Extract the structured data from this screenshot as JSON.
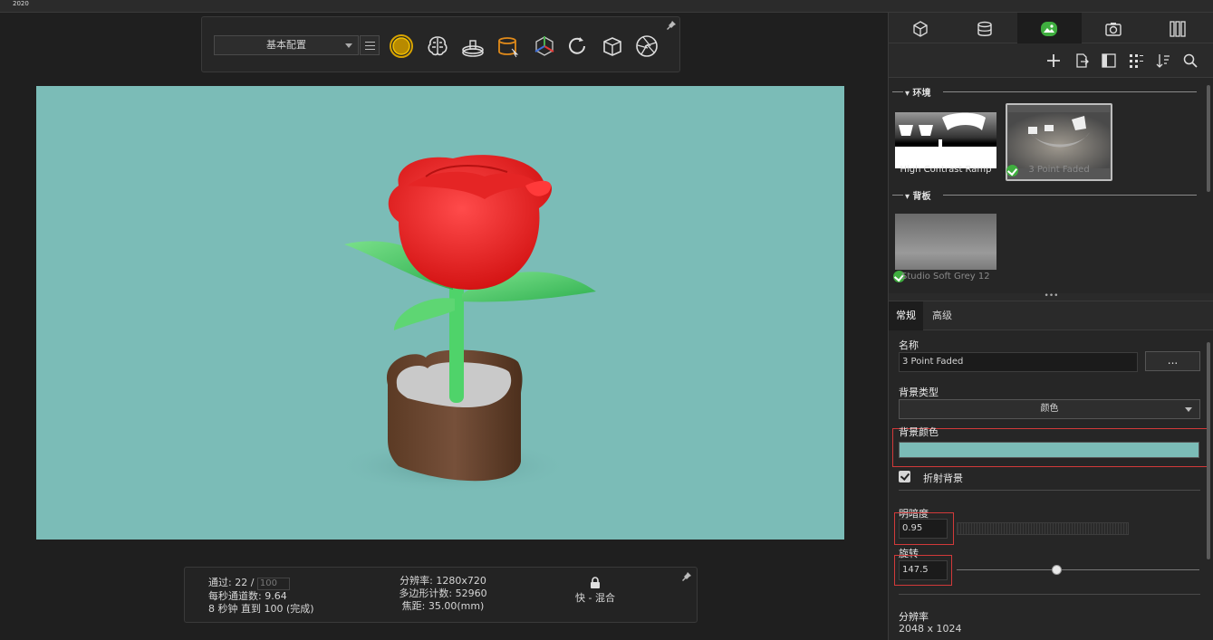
{
  "top_strip": {
    "year": "2020"
  },
  "toolbar": {
    "preset_value": "基本配置",
    "icons": [
      "sphere-icon",
      "brain-icon",
      "turntable-icon",
      "material-bucket-icon",
      "transform-icon",
      "refresh-icon",
      "box-icon",
      "aperture-icon"
    ]
  },
  "canvas": {
    "background_color": "#7bbcb7"
  },
  "status": {
    "pass_label": "通过:",
    "pass_current": "22 /",
    "pass_total": "100",
    "per_second_label": "每秒通道数:",
    "per_second_value": "9.64",
    "time_line": "8 秒钟 直到 100 (完成)",
    "resolution_line": "分辨率: 1280x720",
    "polygon_line": "多边形计数: 52960",
    "focal_line": "焦距: 35.00(mm)",
    "mode_label": "快 - 混合"
  },
  "right_tabs": [
    "cube-icon",
    "database-icon",
    "environment-icon",
    "camera-icon",
    "columns-icon"
  ],
  "right_actions": [
    "add-icon",
    "export-icon",
    "panel-icon",
    "grid-icon",
    "sort-icon",
    "search-icon"
  ],
  "library": {
    "env_section": "▾ 环境",
    "env_items": [
      {
        "label": "High Contrast Ramp"
      },
      {
        "label": "3 Point Faded"
      }
    ],
    "backplate_section": "▾ 背板",
    "backplate_items": [
      {
        "label": "Studio Soft Grey 12"
      }
    ]
  },
  "properties": {
    "tabs": [
      "常规",
      "高级"
    ],
    "name_label": "名称",
    "name_value": "3 Point Faded",
    "ellipsis": "...",
    "bg_type_label": "背景类型",
    "bg_type_value": "颜色",
    "bg_color_label": "背景颜色",
    "bg_color_value": "#7bbcb7",
    "refract_bg_label": "折射背景",
    "brightness_label": "明暗度",
    "brightness_value": "0.95",
    "rotation_label": "旋转",
    "rotation_value": "147.5",
    "resolution_label": "分辨率",
    "resolution_value": "2048 x 1024"
  }
}
